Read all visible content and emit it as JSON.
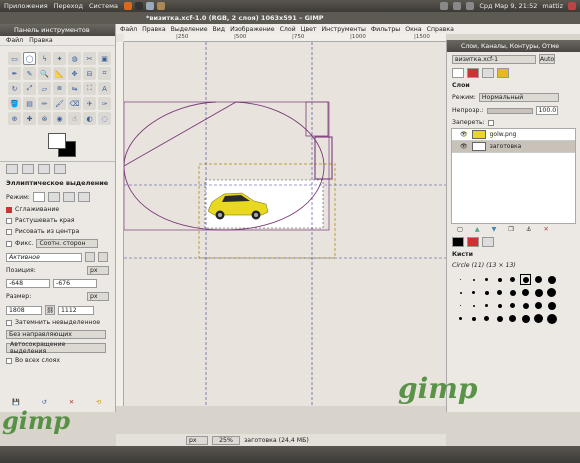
{
  "top_panel": {
    "menus": [
      "Приложения",
      "Переход",
      "Система"
    ],
    "datetime": "Срд Мар  9, 21:52",
    "user": "mattiz"
  },
  "window": {
    "title": "*визитка.xcf-1.0 (RGB, 2 слоя) 1063x591 – GIMP"
  },
  "menubar": [
    "Файл",
    "Правка",
    "Выделение",
    "Вид",
    "Изображение",
    "Слой",
    "Цвет",
    "Инструменты",
    "Фильтры",
    "Окна",
    "Справка"
  ],
  "toolbox": {
    "title": "Панель инструментов",
    "menu": [
      "Файл",
      "Правка"
    ],
    "tool_icons": [
      "rect-select-icon",
      "ellipse-select-icon",
      "lasso-icon",
      "fuzzy-select-icon",
      "color-select-icon",
      "scissors-icon",
      "foreground-select-icon",
      "paths-icon",
      "color-picker-icon",
      "zoom-icon",
      "measure-icon",
      "move-icon",
      "align-icon",
      "crop-icon",
      "rotate-icon",
      "scale-icon",
      "shear-icon",
      "perspective-icon",
      "flip-icon",
      "cage-icon",
      "text-icon",
      "bucket-fill-icon",
      "blend-icon",
      "pencil-icon",
      "paintbrush-icon",
      "eraser-icon",
      "airbrush-icon",
      "ink-icon",
      "clone-icon",
      "heal-icon",
      "perspective-clone-icon",
      "blur-icon",
      "smudge-icon",
      "dodge-burn-icon",
      "extra-icon"
    ]
  },
  "options": {
    "title": "Эллиптическое выделение",
    "mode_label": "Режим:",
    "antialias": "Сглаживание",
    "feather": "Растушевать края",
    "from_center": "Рисовать из центра",
    "fixed_label": "Фикс.",
    "fixed_value": "Соотн. сторон",
    "active_value": "Активное",
    "position_label": "Позиция:",
    "position_x": "-648",
    "position_y": "-676",
    "size_label": "Размер:",
    "size_w": "1808",
    "size_h": "1112",
    "unit": "px",
    "darken": "Затемнить невыделенное",
    "guides_value": "Без направляющих",
    "autoshrink": "Автосокращение выделения",
    "all_layers": "Во всех слоях"
  },
  "canvas": {
    "ruler_labels": [
      "|250",
      "|500",
      "|750",
      "|1000",
      "|1500"
    ],
    "zoom_unit": "px",
    "zoom": "25%",
    "status": "заготовка (24,4 МБ)"
  },
  "dock": {
    "title": "Слои, Каналы, Контуры, Отме",
    "image_select": "визитка.xcf-1",
    "layers_title": "Слои",
    "mode_label": "Режим:",
    "mode_value": "Нормальный",
    "opacity_label": "Непрозр.:",
    "opacity_value": "100.0",
    "lock_label": "Запереть:",
    "layers": [
      "golw.png",
      "заготовка"
    ],
    "brushes_title": "Кисти",
    "brush_name": "Circle (11) (13 × 13)"
  },
  "watermark": "gimp",
  "colors": {
    "selection": "#7a3a78",
    "guide": "#3a3a9a",
    "car": "#e8d820"
  }
}
